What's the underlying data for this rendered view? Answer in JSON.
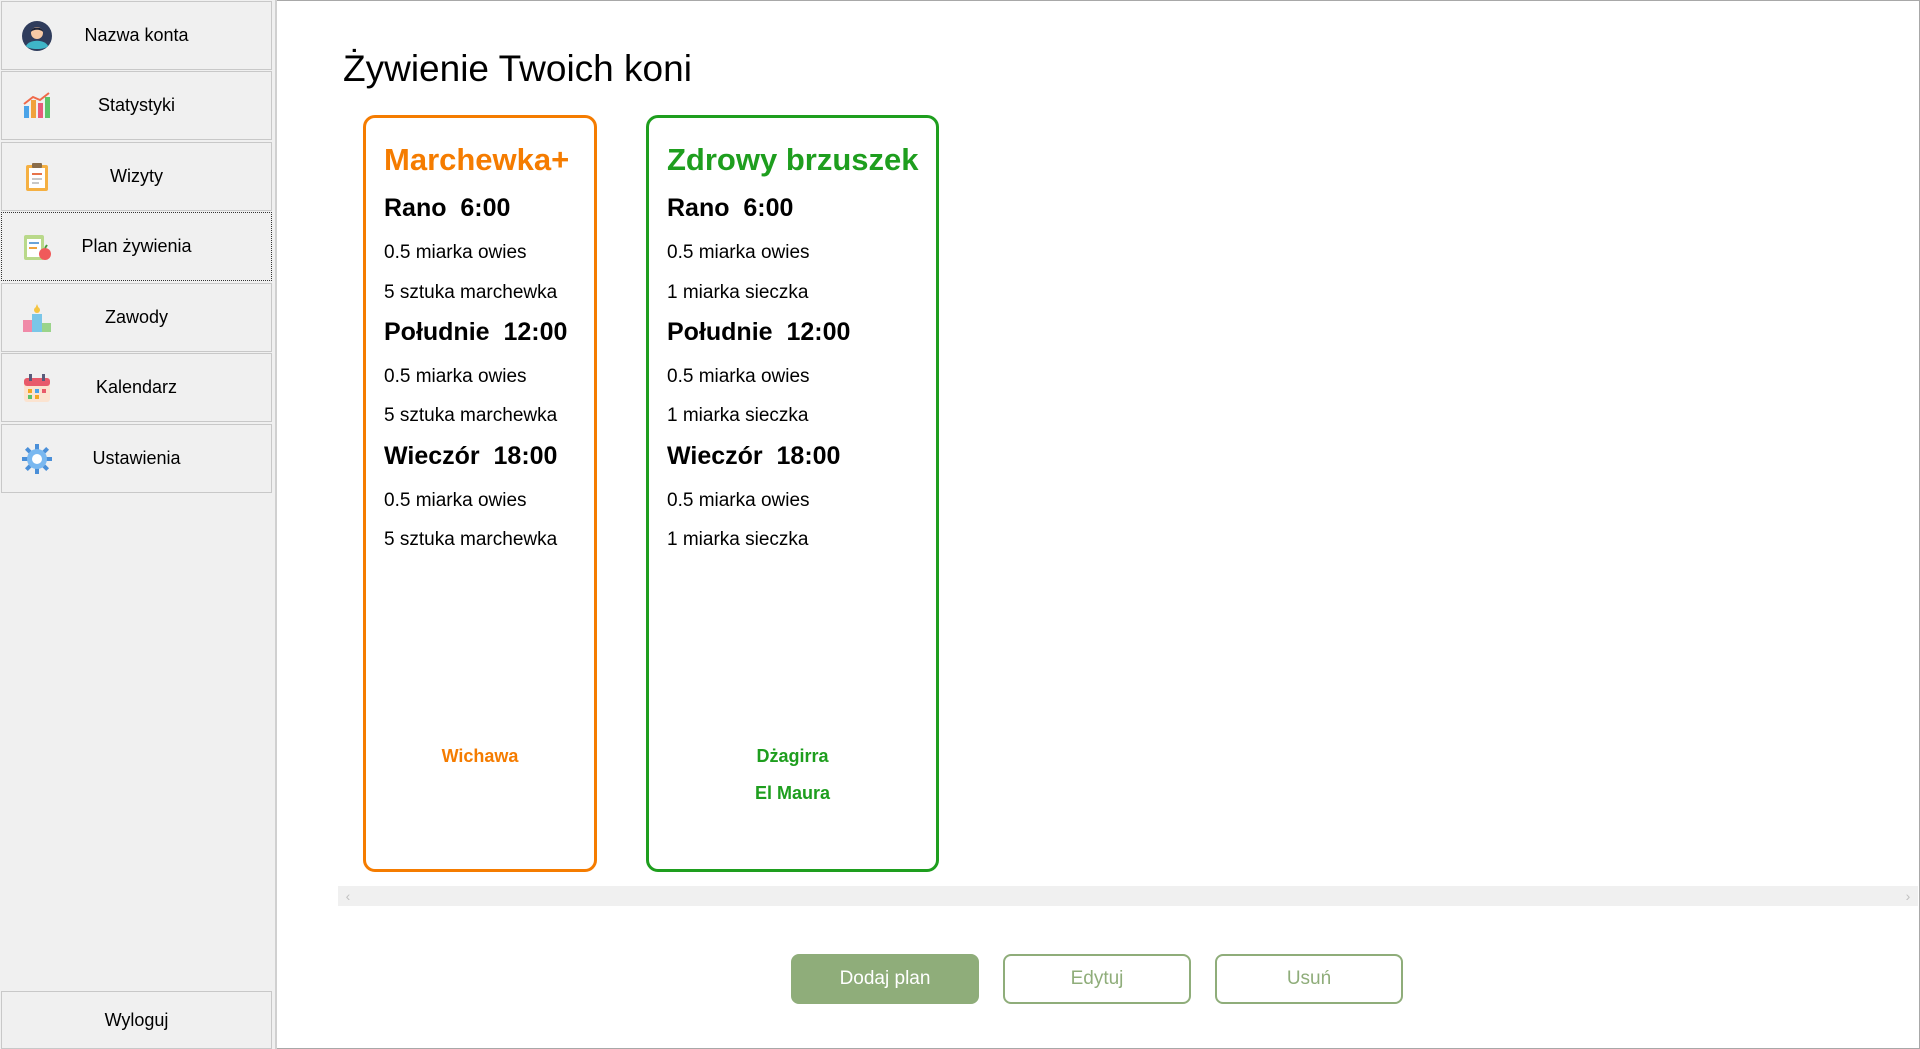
{
  "sidebar": {
    "items": [
      {
        "label": "Nazwa konta",
        "icon": "account-avatar-icon"
      },
      {
        "label": "Statystyki",
        "icon": "bar-chart-icon"
      },
      {
        "label": "Wizyty",
        "icon": "clipboard-icon"
      },
      {
        "label": "Plan żywienia",
        "icon": "nutrition-plan-icon",
        "active": true
      },
      {
        "label": "Zawody",
        "icon": "podium-icon"
      },
      {
        "label": "Kalendarz",
        "icon": "calendar-icon"
      },
      {
        "label": "Ustawienia",
        "icon": "gear-icon"
      }
    ],
    "logout_label": "Wyloguj"
  },
  "main": {
    "title": "Żywienie Twoich koni",
    "plans": [
      {
        "name": "Marchewka+",
        "color": "#f57c00",
        "meals": [
          {
            "heading": "Rano  6:00",
            "items": [
              "0.5 miarka owies",
              "5 sztuka marchewka"
            ]
          },
          {
            "heading": "Południe  12:00",
            "items": [
              "0.5 miarka owies",
              "5 sztuka marchewka"
            ]
          },
          {
            "heading": "Wieczór  18:00",
            "items": [
              "0.5 miarka owies",
              "5 sztuka marchewka"
            ]
          }
        ],
        "horses": [
          "Wichawa"
        ]
      },
      {
        "name": "Zdrowy brzuszek",
        "color": "#1e9e1e",
        "meals": [
          {
            "heading": "Rano  6:00",
            "items": [
              "0.5 miarka owies",
              "1 miarka sieczka"
            ]
          },
          {
            "heading": "Południe  12:00",
            "items": [
              "0.5 miarka owies",
              "1 miarka sieczka"
            ]
          },
          {
            "heading": "Wieczór  18:00",
            "items": [
              "0.5 miarka owies",
              "1 miarka sieczka"
            ]
          }
        ],
        "horses": [
          "Dżagirra",
          "El Maura"
        ]
      }
    ],
    "buttons": {
      "add": "Dodaj plan",
      "edit": "Edytuj",
      "delete": "Usuń"
    },
    "accent_color": "#8fad7a"
  }
}
